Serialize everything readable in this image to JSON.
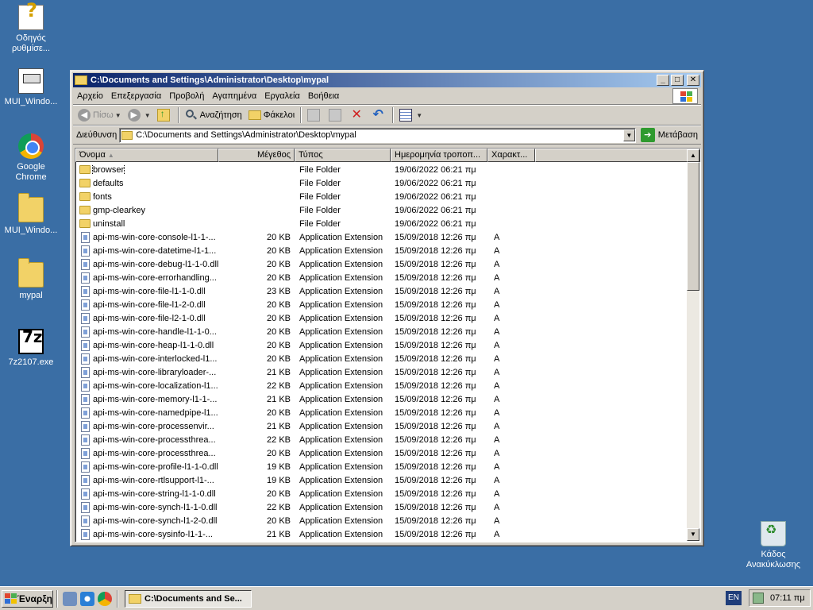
{
  "desktop": {
    "icons": [
      {
        "label": "Οδηγός ρυθμίσε...",
        "icon": "help-wizard-icon"
      },
      {
        "label": "MUI_Windo...",
        "icon": "document-icon"
      },
      {
        "label": "Google Chrome",
        "icon": "chrome-icon"
      },
      {
        "label": "MUI_Windo...",
        "icon": "folder-icon"
      },
      {
        "label": "mypal",
        "icon": "folder-icon"
      },
      {
        "label": "7z2107.exe",
        "icon": "7zip-icon"
      },
      {
        "label": "Κάδος Ανακύκλωσης",
        "icon": "recycle-bin-icon"
      }
    ]
  },
  "window": {
    "title": "C:\\Documents and Settings\\Administrator\\Desktop\\mypal",
    "menu": [
      "Αρχείο",
      "Επεξεργασία",
      "Προβολή",
      "Αγαπημένα",
      "Εργαλεία",
      "Βοήθεια"
    ],
    "toolbar": {
      "back": "Πίσω",
      "search": "Αναζήτηση",
      "folders": "Φάκελοι"
    },
    "address": {
      "label": "Διεύθυνση",
      "value": "C:\\Documents and Settings\\Administrator\\Desktop\\mypal",
      "go": "Μετάβαση"
    },
    "columns": {
      "name": "Όνομα",
      "size": "Μέγεθος",
      "type": "Τύπος",
      "date": "Ημερομηνία τροποπ...",
      "attr": "Χαρακτ..."
    },
    "files": [
      {
        "name": "browser",
        "size": "",
        "type": "File Folder",
        "date": "19/06/2022 06:21 πμ",
        "attr": "",
        "kind": "folder"
      },
      {
        "name": "defaults",
        "size": "",
        "type": "File Folder",
        "date": "19/06/2022 06:21 πμ",
        "attr": "",
        "kind": "folder"
      },
      {
        "name": "fonts",
        "size": "",
        "type": "File Folder",
        "date": "19/06/2022 06:21 πμ",
        "attr": "",
        "kind": "folder"
      },
      {
        "name": "gmp-clearkey",
        "size": "",
        "type": "File Folder",
        "date": "19/06/2022 06:21 πμ",
        "attr": "",
        "kind": "folder"
      },
      {
        "name": "uninstall",
        "size": "",
        "type": "File Folder",
        "date": "19/06/2022 06:21 πμ",
        "attr": "",
        "kind": "folder"
      },
      {
        "name": "api-ms-win-core-console-l1-1-...",
        "size": "20 KB",
        "type": "Application Extension",
        "date": "15/09/2018 12:26 πμ",
        "attr": "A",
        "kind": "dll"
      },
      {
        "name": "api-ms-win-core-datetime-l1-1...",
        "size": "20 KB",
        "type": "Application Extension",
        "date": "15/09/2018 12:26 πμ",
        "attr": "A",
        "kind": "dll"
      },
      {
        "name": "api-ms-win-core-debug-l1-1-0.dll",
        "size": "20 KB",
        "type": "Application Extension",
        "date": "15/09/2018 12:26 πμ",
        "attr": "A",
        "kind": "dll"
      },
      {
        "name": "api-ms-win-core-errorhandling...",
        "size": "20 KB",
        "type": "Application Extension",
        "date": "15/09/2018 12:26 πμ",
        "attr": "A",
        "kind": "dll"
      },
      {
        "name": "api-ms-win-core-file-l1-1-0.dll",
        "size": "23 KB",
        "type": "Application Extension",
        "date": "15/09/2018 12:26 πμ",
        "attr": "A",
        "kind": "dll"
      },
      {
        "name": "api-ms-win-core-file-l1-2-0.dll",
        "size": "20 KB",
        "type": "Application Extension",
        "date": "15/09/2018 12:26 πμ",
        "attr": "A",
        "kind": "dll"
      },
      {
        "name": "api-ms-win-core-file-l2-1-0.dll",
        "size": "20 KB",
        "type": "Application Extension",
        "date": "15/09/2018 12:26 πμ",
        "attr": "A",
        "kind": "dll"
      },
      {
        "name": "api-ms-win-core-handle-l1-1-0...",
        "size": "20 KB",
        "type": "Application Extension",
        "date": "15/09/2018 12:26 πμ",
        "attr": "A",
        "kind": "dll"
      },
      {
        "name": "api-ms-win-core-heap-l1-1-0.dll",
        "size": "20 KB",
        "type": "Application Extension",
        "date": "15/09/2018 12:26 πμ",
        "attr": "A",
        "kind": "dll"
      },
      {
        "name": "api-ms-win-core-interlocked-l1...",
        "size": "20 KB",
        "type": "Application Extension",
        "date": "15/09/2018 12:26 πμ",
        "attr": "A",
        "kind": "dll"
      },
      {
        "name": "api-ms-win-core-libraryloader-...",
        "size": "21 KB",
        "type": "Application Extension",
        "date": "15/09/2018 12:26 πμ",
        "attr": "A",
        "kind": "dll"
      },
      {
        "name": "api-ms-win-core-localization-l1...",
        "size": "22 KB",
        "type": "Application Extension",
        "date": "15/09/2018 12:26 πμ",
        "attr": "A",
        "kind": "dll"
      },
      {
        "name": "api-ms-win-core-memory-l1-1-...",
        "size": "21 KB",
        "type": "Application Extension",
        "date": "15/09/2018 12:26 πμ",
        "attr": "A",
        "kind": "dll"
      },
      {
        "name": "api-ms-win-core-namedpipe-l1...",
        "size": "20 KB",
        "type": "Application Extension",
        "date": "15/09/2018 12:26 πμ",
        "attr": "A",
        "kind": "dll"
      },
      {
        "name": "api-ms-win-core-processenvir...",
        "size": "21 KB",
        "type": "Application Extension",
        "date": "15/09/2018 12:26 πμ",
        "attr": "A",
        "kind": "dll"
      },
      {
        "name": "api-ms-win-core-processthrea...",
        "size": "22 KB",
        "type": "Application Extension",
        "date": "15/09/2018 12:26 πμ",
        "attr": "A",
        "kind": "dll"
      },
      {
        "name": "api-ms-win-core-processthrea...",
        "size": "20 KB",
        "type": "Application Extension",
        "date": "15/09/2018 12:26 πμ",
        "attr": "A",
        "kind": "dll"
      },
      {
        "name": "api-ms-win-core-profile-l1-1-0.dll",
        "size": "19 KB",
        "type": "Application Extension",
        "date": "15/09/2018 12:26 πμ",
        "attr": "A",
        "kind": "dll"
      },
      {
        "name": "api-ms-win-core-rtlsupport-l1-...",
        "size": "19 KB",
        "type": "Application Extension",
        "date": "15/09/2018 12:26 πμ",
        "attr": "A",
        "kind": "dll"
      },
      {
        "name": "api-ms-win-core-string-l1-1-0.dll",
        "size": "20 KB",
        "type": "Application Extension",
        "date": "15/09/2018 12:26 πμ",
        "attr": "A",
        "kind": "dll"
      },
      {
        "name": "api-ms-win-core-synch-l1-1-0.dll",
        "size": "22 KB",
        "type": "Application Extension",
        "date": "15/09/2018 12:26 πμ",
        "attr": "A",
        "kind": "dll"
      },
      {
        "name": "api-ms-win-core-synch-l1-2-0.dll",
        "size": "20 KB",
        "type": "Application Extension",
        "date": "15/09/2018 12:26 πμ",
        "attr": "A",
        "kind": "dll"
      },
      {
        "name": "api-ms-win-core-sysinfo-l1-1-...",
        "size": "21 KB",
        "type": "Application Extension",
        "date": "15/09/2018 12:26 πμ",
        "attr": "A",
        "kind": "dll"
      }
    ]
  },
  "taskbar": {
    "start": "Έναρξη",
    "task": "C:\\Documents and Se...",
    "lang": "EN",
    "clock": "07:11 πμ"
  }
}
